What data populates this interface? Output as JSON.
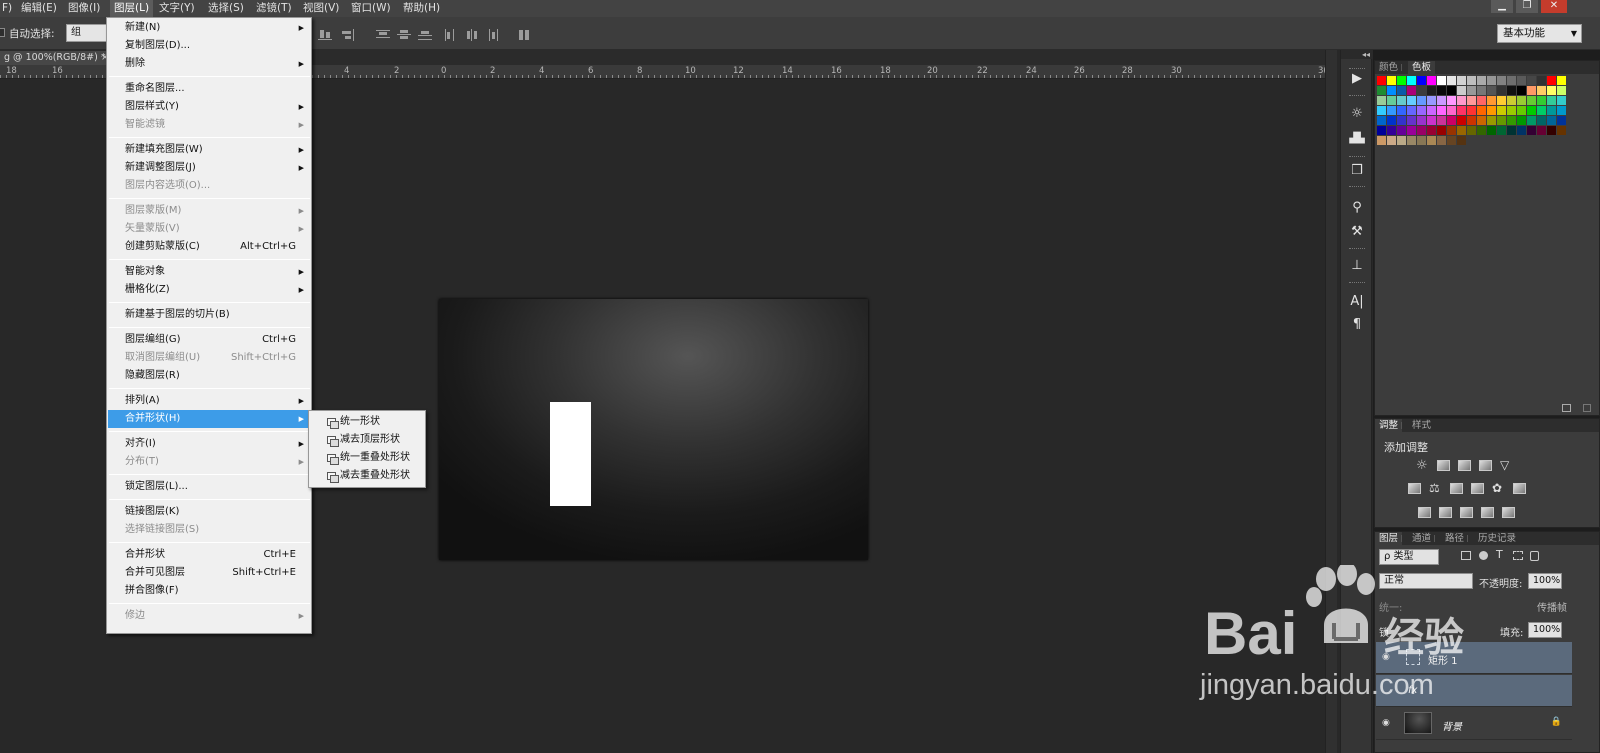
{
  "menubar": {
    "items": [
      "F)",
      "编辑(E)",
      "图像(I)",
      "图层(L)",
      "文字(Y)",
      "选择(S)",
      "滤镜(T)",
      "视图(V)",
      "窗口(W)",
      "帮助(H)"
    ],
    "active_index": 3
  },
  "window_controls": [
    "▁",
    "❐",
    "✕"
  ],
  "options_bar": {
    "auto_select_label": "自动选择:",
    "auto_select_value": "组",
    "workspace": "基本功能"
  },
  "document_tab": {
    "title": "g @ 100%(RGB/8#) *",
    "close": "×"
  },
  "ruler": {
    "labels": [
      "18",
      "16",
      "4",
      "2",
      "0",
      "2",
      "4",
      "6",
      "8",
      "10",
      "12",
      "14",
      "16",
      "18",
      "20",
      "22",
      "24",
      "26",
      "28",
      "30",
      "3("
    ]
  },
  "panel_strip": {
    "collapse_glyph": "◂◂",
    "icons": [
      "play-icon",
      "brightness-icon",
      "histogram-icon",
      "cube-icon",
      "brush-icon",
      "paint-icon",
      "stamp-icon",
      "character-icon",
      "paragraph-icon"
    ]
  },
  "swatches_panel": {
    "tabs": [
      "颜色",
      "色板"
    ],
    "active_tab": 1,
    "colors": [
      "#ff0000",
      "#ffff00",
      "#00ff00",
      "#00ffff",
      "#0000ff",
      "#ff00ff",
      "#ffffff",
      "#e6e6e6",
      "#d2d2d2",
      "#bebebe",
      "#aaaaaa",
      "#969696",
      "#828282",
      "#6e6e6e",
      "#5a5a5a",
      "#464646",
      "#323232",
      "#ff0000",
      "#ffff00",
      "#1e8c32",
      "#008cff",
      "#0a5aaa",
      "#aa0078",
      "#3c3c3c",
      "#1e1e1e",
      "#0a0a0a",
      "#000000",
      "#cccccc",
      "#999999",
      "#777777",
      "#555555",
      "#333333",
      "#111111",
      "#000000",
      "#ff9966",
      "#ffcc66",
      "#ffff66",
      "#ccff66",
      "#99cc99",
      "#66cc99",
      "#66cccc",
      "#66ccff",
      "#6699ff",
      "#9999ff",
      "#cc99ff",
      "#ff99ff",
      "#ff99cc",
      "#ff9999",
      "#ff6666",
      "#ff9933",
      "#ffcc33",
      "#cccc33",
      "#99cc33",
      "#66cc33",
      "#33cc33",
      "#33cc99",
      "#33cccc",
      "#33ccff",
      "#3399ff",
      "#3366ff",
      "#6666ff",
      "#9966ff",
      "#cc66ff",
      "#ff66ff",
      "#ff66cc",
      "#ff3366",
      "#ff3333",
      "#ff6600",
      "#ff9900",
      "#cccc00",
      "#99cc00",
      "#66cc00",
      "#00cc00",
      "#00cc66",
      "#009999",
      "#0099cc",
      "#0066cc",
      "#0033cc",
      "#3333cc",
      "#6633cc",
      "#9933cc",
      "#cc33cc",
      "#cc3399",
      "#cc0066",
      "#cc0000",
      "#cc3300",
      "#cc6600",
      "#999900",
      "#669900",
      "#339900",
      "#009900",
      "#009966",
      "#006666",
      "#006699",
      "#003399",
      "#000099",
      "#330099",
      "#660099",
      "#990099",
      "#990066",
      "#990033",
      "#990000",
      "#993300",
      "#996600",
      "#666600",
      "#336600",
      "#006600",
      "#006633",
      "#003333",
      "#003366",
      "#330033",
      "#660033",
      "#330000",
      "#663300",
      "#cc9966",
      "#ccaa88",
      "#bbaa88",
      "#998866",
      "#887755",
      "#aa8855",
      "#886644",
      "#664422",
      "#553311"
    ]
  },
  "adjustments_panel": {
    "tabs": [
      "调整",
      "样式"
    ],
    "active_tab": 0,
    "title": "添加调整"
  },
  "layers_panel": {
    "tabs": [
      "图层",
      "通道",
      "路径",
      "历史记录"
    ],
    "active_tab": 0,
    "filter_label": "ρ 类型",
    "blend_mode": "正常",
    "opacity_label": "不透明度:",
    "opacity_value": "100%",
    "unify_label": "统一:",
    "propagate_label": "传播帧",
    "lock_label": "锁",
    "fill_label": "填充:",
    "fill_value": "100%",
    "layers": [
      {
        "name": "矩形 1",
        "selected": true
      },
      {
        "name": "fx",
        "selected": true
      },
      {
        "name": "背景",
        "selected": false
      }
    ]
  },
  "layer_menu": {
    "items": [
      {
        "label": "新建(N)",
        "shortcut": "",
        "submenu": true,
        "disabled": false
      },
      {
        "label": "复制图层(D)...",
        "shortcut": "",
        "submenu": false,
        "disabled": false
      },
      {
        "label": "删除",
        "shortcut": "",
        "submenu": true,
        "disabled": false
      },
      {
        "sep": true
      },
      {
        "label": "重命名图层...",
        "shortcut": "",
        "submenu": false,
        "disabled": false
      },
      {
        "label": "图层样式(Y)",
        "shortcut": "",
        "submenu": true,
        "disabled": false
      },
      {
        "label": "智能滤镜",
        "shortcut": "",
        "submenu": true,
        "disabled": true
      },
      {
        "sep": true
      },
      {
        "label": "新建填充图层(W)",
        "shortcut": "",
        "submenu": true,
        "disabled": false
      },
      {
        "label": "新建调整图层(J)",
        "shortcut": "",
        "submenu": true,
        "disabled": false
      },
      {
        "label": "图层内容选项(O)...",
        "shortcut": "",
        "submenu": false,
        "disabled": true
      },
      {
        "sep": true
      },
      {
        "label": "图层蒙版(M)",
        "shortcut": "",
        "submenu": true,
        "disabled": true
      },
      {
        "label": "矢量蒙版(V)",
        "shortcut": "",
        "submenu": true,
        "disabled": true
      },
      {
        "label": "创建剪贴蒙版(C)",
        "shortcut": "Alt+Ctrl+G",
        "submenu": false,
        "disabled": false
      },
      {
        "sep": true
      },
      {
        "label": "智能对象",
        "shortcut": "",
        "submenu": true,
        "disabled": false
      },
      {
        "label": "栅格化(Z)",
        "shortcut": "",
        "submenu": true,
        "disabled": false
      },
      {
        "sep": true
      },
      {
        "label": "新建基于图层的切片(B)",
        "shortcut": "",
        "submenu": false,
        "disabled": false
      },
      {
        "sep": true
      },
      {
        "label": "图层编组(G)",
        "shortcut": "Ctrl+G",
        "submenu": false,
        "disabled": false
      },
      {
        "label": "取消图层编组(U)",
        "shortcut": "Shift+Ctrl+G",
        "submenu": false,
        "disabled": true
      },
      {
        "label": "隐藏图层(R)",
        "shortcut": "",
        "submenu": false,
        "disabled": false
      },
      {
        "sep": true
      },
      {
        "label": "排列(A)",
        "shortcut": "",
        "submenu": true,
        "disabled": false
      },
      {
        "label": "合并形状(H)",
        "shortcut": "",
        "submenu": true,
        "disabled": false,
        "highlighted": true
      },
      {
        "sep": true
      },
      {
        "label": "对齐(I)",
        "shortcut": "",
        "submenu": true,
        "disabled": false
      },
      {
        "label": "分布(T)",
        "shortcut": "",
        "submenu": true,
        "disabled": true
      },
      {
        "sep": true
      },
      {
        "label": "锁定图层(L)...",
        "shortcut": "",
        "submenu": false,
        "disabled": false
      },
      {
        "sep": true
      },
      {
        "label": "链接图层(K)",
        "shortcut": "",
        "submenu": false,
        "disabled": false
      },
      {
        "label": "选择链接图层(S)",
        "shortcut": "",
        "submenu": false,
        "disabled": true
      },
      {
        "sep": true
      },
      {
        "label": "合并形状",
        "shortcut": "Ctrl+E",
        "submenu": false,
        "disabled": false
      },
      {
        "label": "合并可见图层",
        "shortcut": "Shift+Ctrl+E",
        "submenu": false,
        "disabled": false
      },
      {
        "label": "拼合图像(F)",
        "shortcut": "",
        "submenu": false,
        "disabled": false
      },
      {
        "sep": true
      },
      {
        "label": "修边",
        "shortcut": "",
        "submenu": true,
        "disabled": true
      }
    ]
  },
  "merge_submenu": {
    "items": [
      "统一形状",
      "减去顶层形状",
      "统一重叠处形状",
      "减去重叠处形状"
    ]
  },
  "watermark": {
    "brand": "Bai",
    "brand_cn": "经验",
    "url": "jingyan.baidu.com"
  }
}
